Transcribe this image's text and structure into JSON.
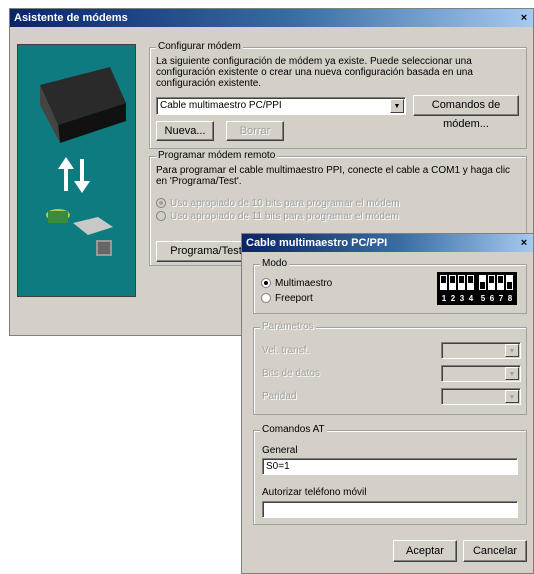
{
  "main_window": {
    "title": "Asistente de módems",
    "close_glyph": "×",
    "config_group": {
      "legend": "Configurar módem",
      "description": "La siguiente configuración de módem ya existe. Puede seleccionar una configuración existente o crear una nueva configuración basada en una configuración existente.",
      "selected_config": "Cable multimaestro PC/PPI",
      "modem_commands_button": "Comandos de módem...",
      "new_button": "Nueva...",
      "delete_button": "Borrar"
    },
    "program_group": {
      "legend": "Programar módem remoto",
      "description": "Para programar el cable multimaestro PPI, conecte el cable a COM1 y haga clic en 'Programa/Test'.",
      "option_10bit": "Uso apropiado de 10 bits para programar el módem",
      "option_11bit": "Uso apropiado de 11 bits para programar el módem",
      "program_button": "Programa/Test"
    }
  },
  "dialog": {
    "title": "Cable multimaestro PC/PPI",
    "close_glyph": "×",
    "mode_group": {
      "legend": "Modo",
      "option_multimaster": "Multimaestro",
      "option_freeport": "Freeport",
      "selected": "Multimaestro",
      "dip_numbers": [
        "1",
        "2",
        "3",
        "4",
        "5",
        "6",
        "7",
        "8"
      ]
    },
    "params_group": {
      "legend": "Parámetros",
      "baud_label": "Vel. transf.",
      "databits_label": "Bits de datos",
      "parity_label": "Paridad"
    },
    "at_group": {
      "legend": "Comandos AT",
      "general_label": "General",
      "general_value": "S0=1",
      "mobile_label": "Autorizar teléfono móvil",
      "mobile_value": ""
    },
    "ok_button": "Aceptar",
    "cancel_button": "Cancelar"
  }
}
